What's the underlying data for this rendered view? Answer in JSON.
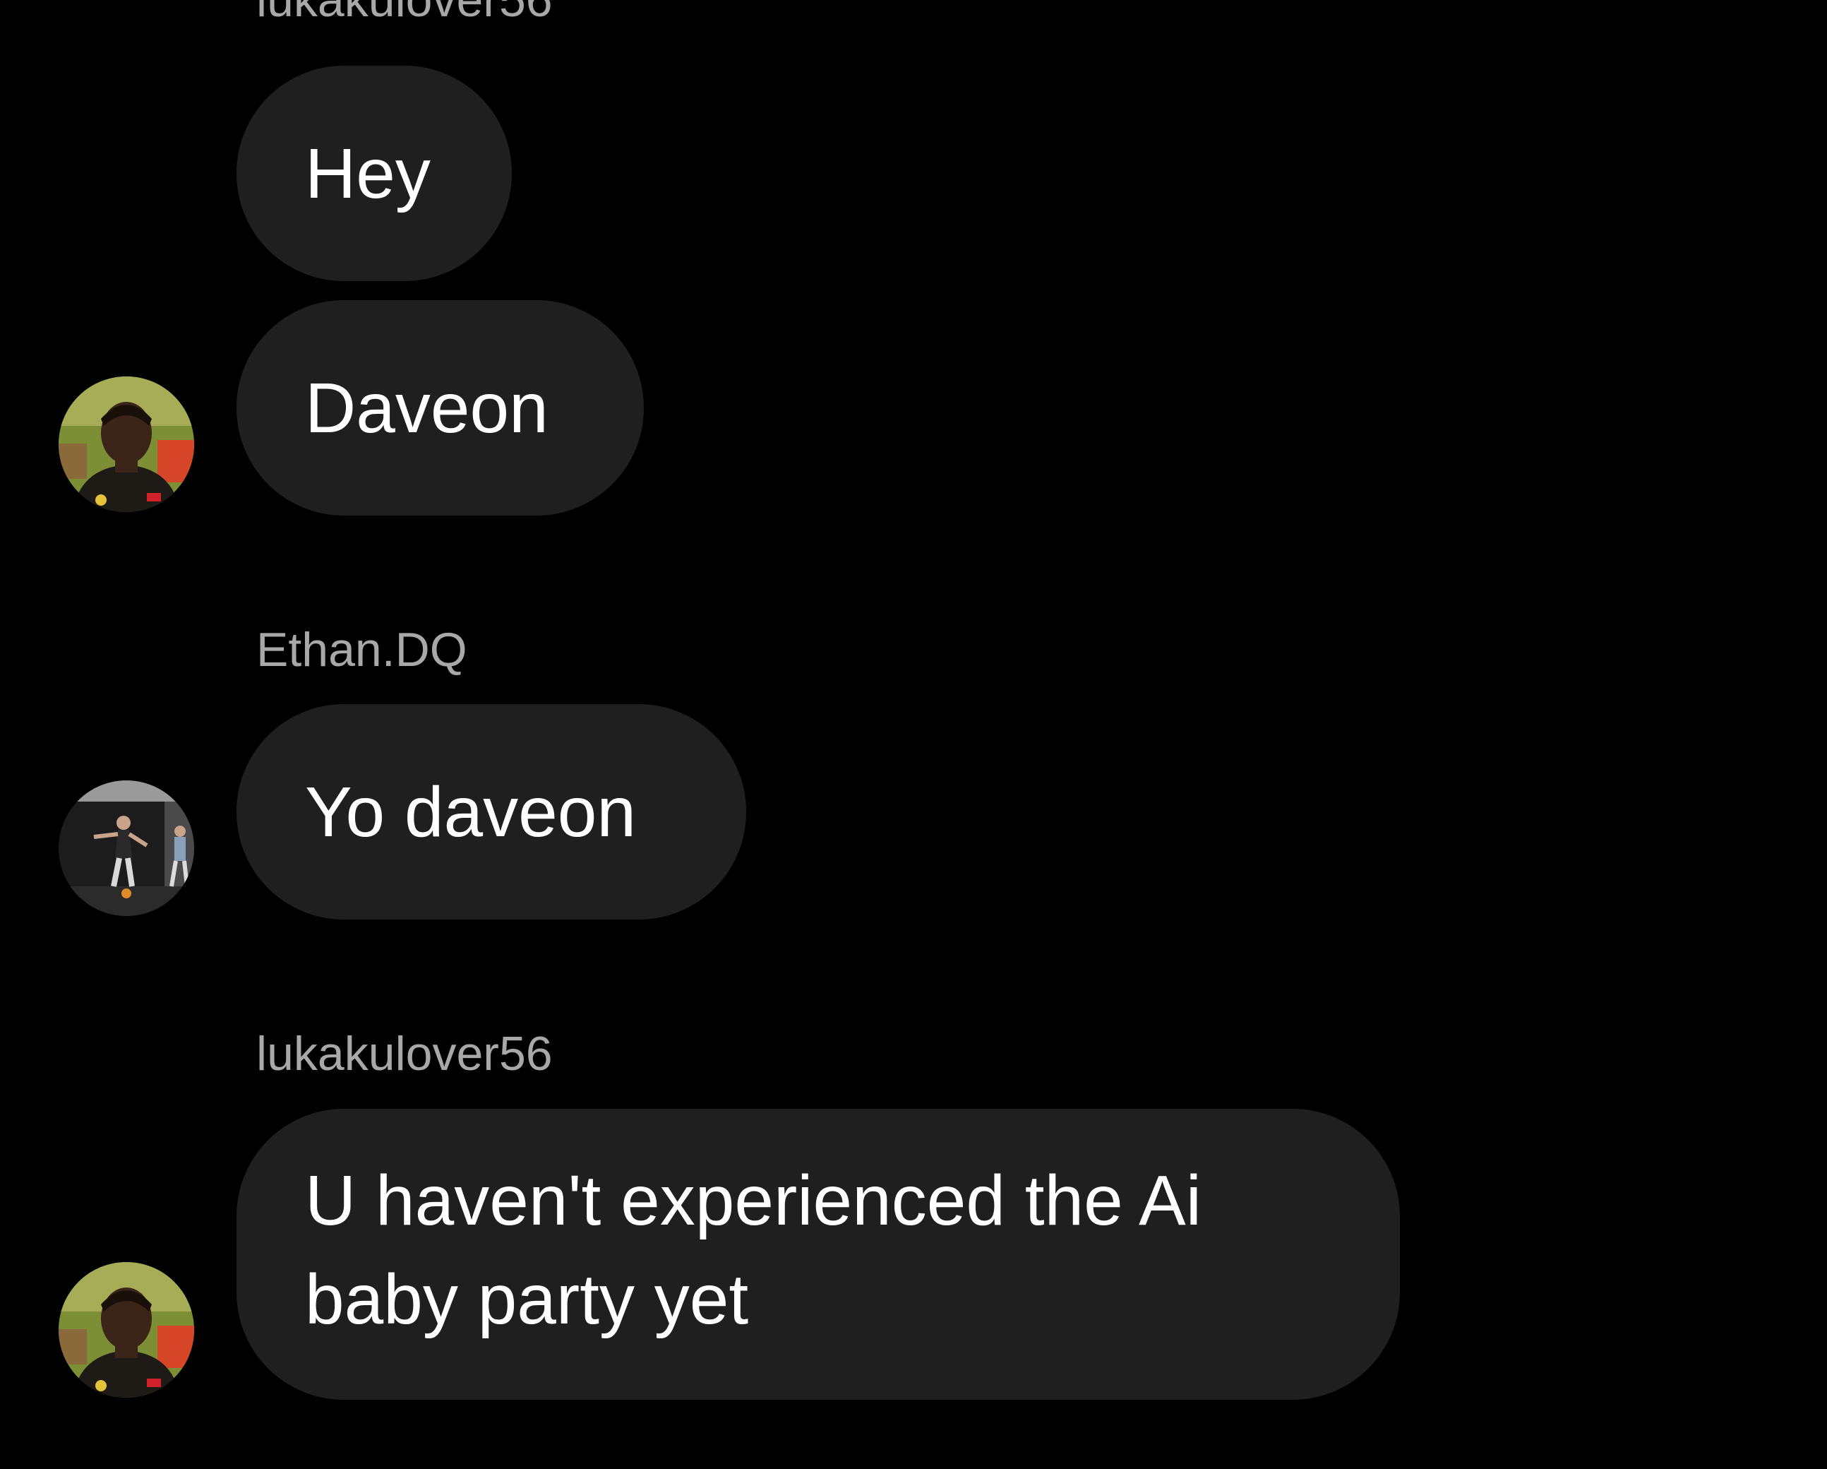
{
  "thread": {
    "messages": [
      {
        "sender": "lukakulover56",
        "text": "Hey"
      },
      {
        "sender": "lukakulover56",
        "text": "Daveon"
      },
      {
        "sender": "Ethan.DQ",
        "text": "Yo daveon"
      },
      {
        "sender": "lukakulover56",
        "text": "U haven't experienced the Ai baby party yet"
      }
    ]
  },
  "colors": {
    "background": "#000000",
    "bubble": "#1f1f1f",
    "sender_name": "#a8a8a8",
    "message_text": "#ffffff"
  },
  "icons": {
    "avatar_lukakulover56": "avatar-portrait-player",
    "avatar_ethan": "avatar-action-photo"
  }
}
